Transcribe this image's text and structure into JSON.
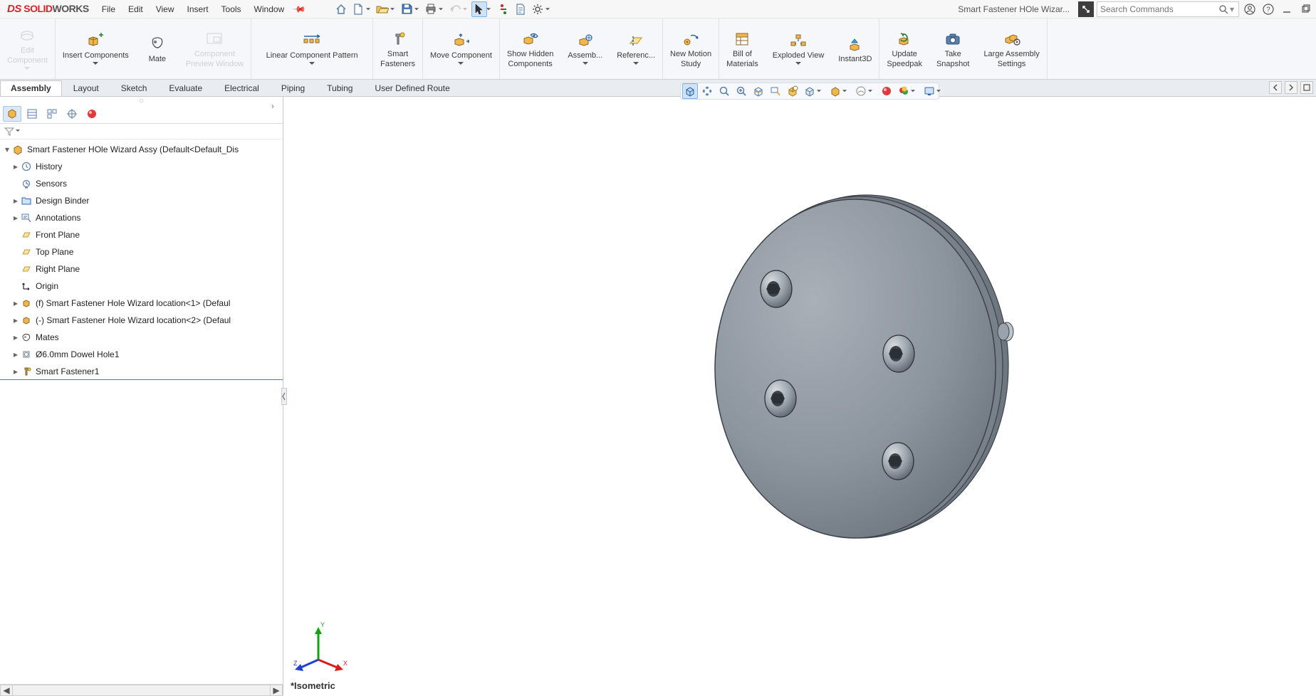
{
  "app": {
    "brand_prefix": "DS",
    "brand_solid": "SOLID",
    "brand_works": "WORKS",
    "doc_title": "Smart Fastener HOle Wizar...",
    "search_placeholder": "Search Commands"
  },
  "menu": {
    "file": "File",
    "edit": "Edit",
    "view": "View",
    "insert": "Insert",
    "tools": "Tools",
    "window": "Window"
  },
  "ribbon": {
    "edit_component": "Edit\nComponent",
    "insert_components": "Insert Components",
    "mate": "Mate",
    "component_preview_window": "Component\nPreview Window",
    "linear_component_pattern": "Linear Component Pattern",
    "smart_fasteners": "Smart\nFasteners",
    "move_component": "Move Component",
    "show_hidden_components": "Show Hidden\nComponents",
    "assembly_features": "Assemb...",
    "reference_geometry": "Referenc...",
    "new_motion_study": "New Motion\nStudy",
    "bom": "Bill of\nMaterials",
    "exploded_view": "Exploded View",
    "instant3d": "Instant3D",
    "update_speedpak": "Update\nSpeedpak",
    "take_snapshot": "Take\nSnapshot",
    "large_assembly_settings": "Large Assembly\nSettings"
  },
  "tabs": {
    "assembly": "Assembly",
    "layout": "Layout",
    "sketch": "Sketch",
    "evaluate": "Evaluate",
    "electrical": "Electrical",
    "piping": "Piping",
    "tubing": "Tubing",
    "user_defined_route": "User Defined Route"
  },
  "tree": {
    "root": "Smart Fastener HOle Wizard Assy  (Default<Default_Dis",
    "history": "History",
    "sensors": "Sensors",
    "design_binder": "Design Binder",
    "annotations": "Annotations",
    "front_plane": "Front Plane",
    "top_plane": "Top Plane",
    "right_plane": "Right Plane",
    "origin": "Origin",
    "comp_f": "(f) Smart Fastener Hole Wizard location<1> (Defaul",
    "comp_m": "(-) Smart Fastener Hole Wizard location<2> (Defaul",
    "mates": "Mates",
    "hole_series": "Ø6.0mm Dowel Hole1",
    "smart_fastener": "Smart Fastener1"
  },
  "viewport": {
    "orientation": "*Isometric",
    "axes": {
      "x": "X",
      "y": "Y",
      "z": "Z"
    }
  }
}
